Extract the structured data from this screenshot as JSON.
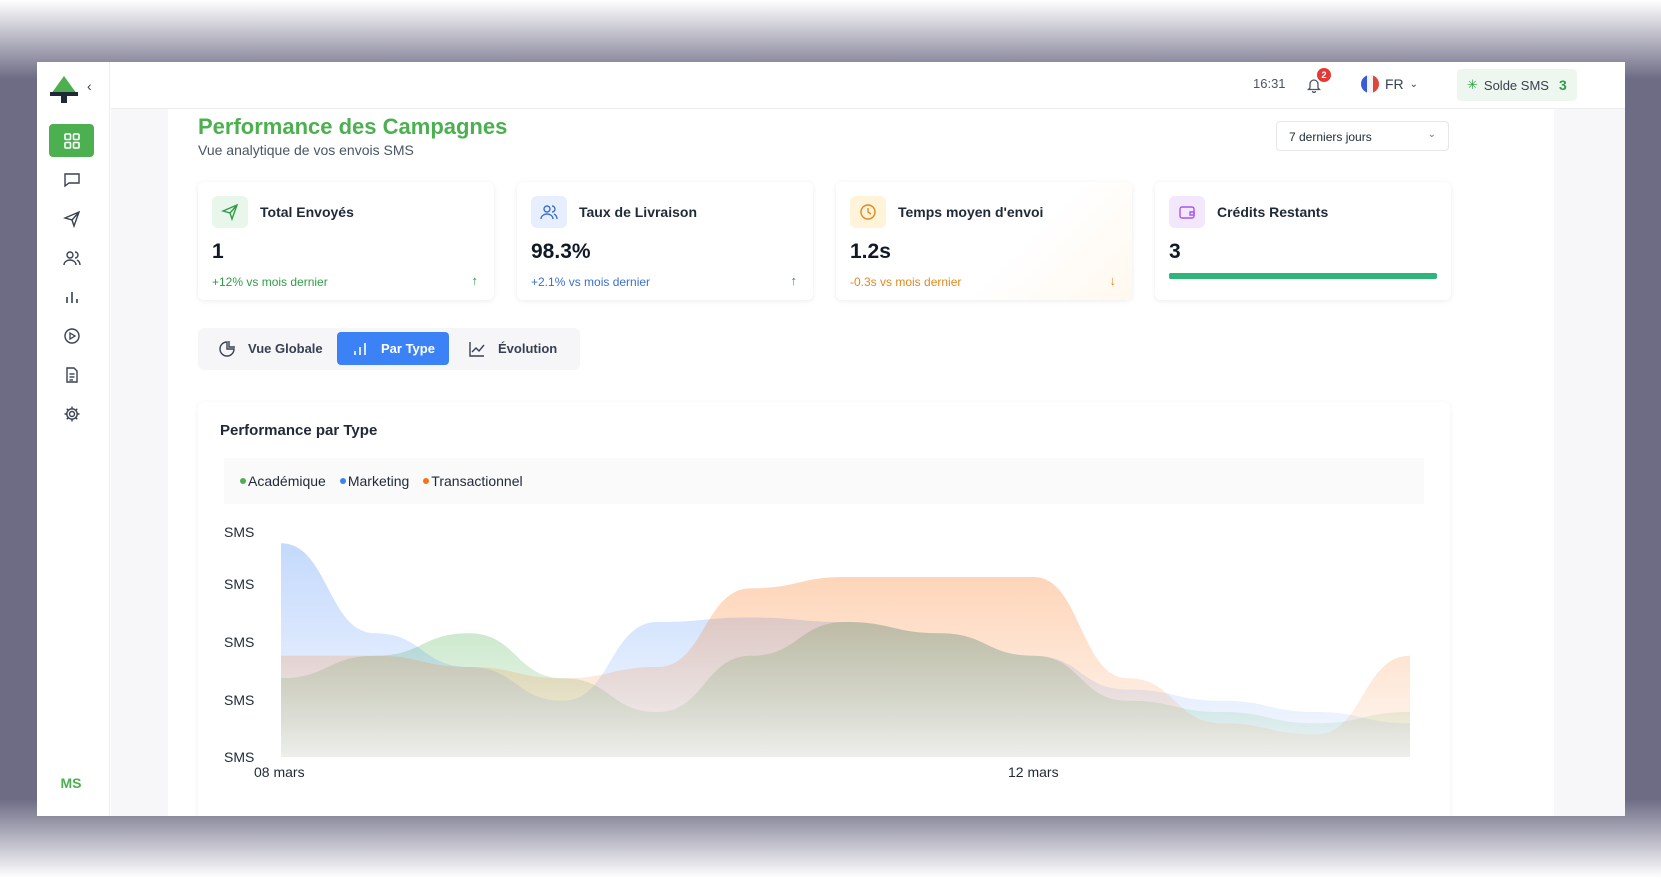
{
  "sidebar": {
    "collapse_icon": "chevron-left-icon",
    "items": [
      {
        "name": "dashboard",
        "icon": "grid-icon",
        "active": true
      },
      {
        "name": "messages",
        "icon": "message-icon",
        "active": false
      },
      {
        "name": "send",
        "icon": "send-icon",
        "active": false
      },
      {
        "name": "contacts",
        "icon": "users-icon",
        "active": false
      },
      {
        "name": "stats",
        "icon": "bar-chart-icon",
        "active": false
      },
      {
        "name": "play",
        "icon": "play-circle-icon",
        "active": false
      },
      {
        "name": "documents",
        "icon": "file-icon",
        "active": false
      },
      {
        "name": "settings",
        "icon": "gear-icon",
        "active": false
      }
    ],
    "avatar": "MS"
  },
  "topbar": {
    "time": "16:31",
    "notifications_count": "2",
    "language": "FR",
    "sms_balance_label": "Solde SMS",
    "sms_balance_value": "3"
  },
  "page": {
    "title": "Performance des Campagnes",
    "subtitle": "Vue analytique de vos envois SMS",
    "period": "7 derniers jours"
  },
  "kpis": [
    {
      "label": "Total Envoyés",
      "value": "1",
      "trend": "+12% vs mois dernier",
      "trend_color": "#2e9e45",
      "icon": "send-icon",
      "icon_bg": "#e8f6ec",
      "direction": "up"
    },
    {
      "label": "Taux de Livraison",
      "value": "98.3%",
      "trend": "+2.1% vs mois dernier",
      "trend_color": "#3b6fd1",
      "icon": "users-icon",
      "icon_bg": "#e7efff",
      "direction": "up"
    },
    {
      "label": "Temps moyen d'envoi",
      "value": "1.2s",
      "trend": "-0.3s vs mois dernier",
      "trend_color": "#e08a1e",
      "icon": "clock-icon",
      "icon_bg": "#fff4d9",
      "direction": "down"
    },
    {
      "label": "Crédits Restants",
      "value": "3",
      "icon": "wallet-icon",
      "icon_bg": "#f3e8fb",
      "progress": 1.0
    }
  ],
  "tabs": [
    {
      "label": "Vue Globale",
      "icon": "pie-chart-icon",
      "active": false
    },
    {
      "label": "Par Type",
      "icon": "bar-chart-icon",
      "active": true
    },
    {
      "label": "Évolution",
      "icon": "line-chart-icon",
      "active": false
    }
  ],
  "chart_data": {
    "type": "area",
    "title": "Performance par Type",
    "x_ticks": [
      "08 mars",
      "12 mars"
    ],
    "y_tick_labels": [
      "SMS",
      "SMS",
      "SMS",
      "SMS",
      "SMS"
    ],
    "series": [
      {
        "name": "Académique",
        "color": "#4caf50",
        "values": [
          0.35,
          0.45,
          0.55,
          0.35,
          0.2,
          0.45,
          0.6,
          0.55,
          0.45,
          0.25,
          0.2,
          0.15,
          0.2
        ]
      },
      {
        "name": "Marketing",
        "color": "#3b82f6",
        "values": [
          0.95,
          0.55,
          0.4,
          0.25,
          0.6,
          0.62,
          0.6,
          0.55,
          0.45,
          0.3,
          0.25,
          0.2,
          0.15
        ]
      },
      {
        "name": "Transactionnel",
        "color": "#f97316",
        "values": [
          0.45,
          0.45,
          0.4,
          0.35,
          0.4,
          0.75,
          0.8,
          0.8,
          0.8,
          0.35,
          0.15,
          0.1,
          0.45
        ]
      }
    ]
  }
}
